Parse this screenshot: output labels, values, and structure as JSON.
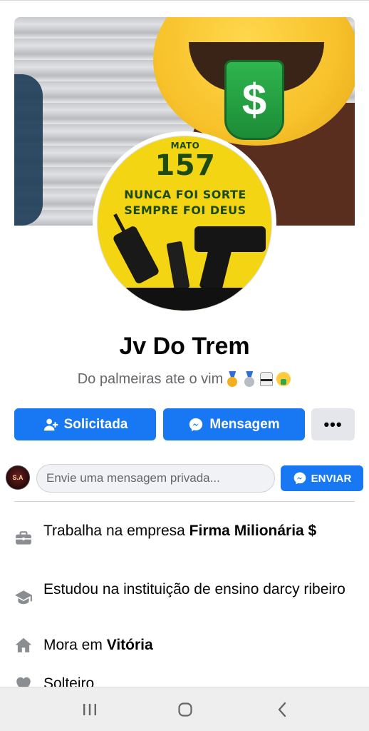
{
  "profile": {
    "name": "Jv Do Trem",
    "bio": "Do palmeiras ate o vim",
    "bio_emojis": [
      "medal-gold",
      "medal-silver",
      "martial-arts-uniform",
      "money-mouth-face"
    ]
  },
  "cover": {
    "icons": [
      "money-mouth-emoji"
    ]
  },
  "avatar": {
    "lines": [
      "MATO",
      "157",
      "NUNCA FOI SORTE",
      "SEMPRE FOI DEUS"
    ]
  },
  "actions": {
    "solicitada_label": "Solicitada",
    "mensagem_label": "Mensagem",
    "more_label": "•••"
  },
  "private_message": {
    "placeholder": "Envie uma mensagem privada...",
    "avatar_text": "S.A",
    "send_label": "ENVIAR"
  },
  "details": {
    "work_prefix": "Trabalha na empresa ",
    "work_company": "Firma Milionária $",
    "education_text": "Estudou na instituição de ensino darcy ribeiro",
    "lives_prefix": "Mora em ",
    "lives_city": "Vitória",
    "relationship_text": "Solteiro"
  },
  "colors": {
    "accent": "#1877f2",
    "secondary_button": "#e4e6eb",
    "muted_text": "#65676b",
    "detail_icon": "#8a8d91"
  },
  "navbar": {
    "icons": [
      "recent-apps-icon",
      "home-icon",
      "back-icon"
    ]
  }
}
